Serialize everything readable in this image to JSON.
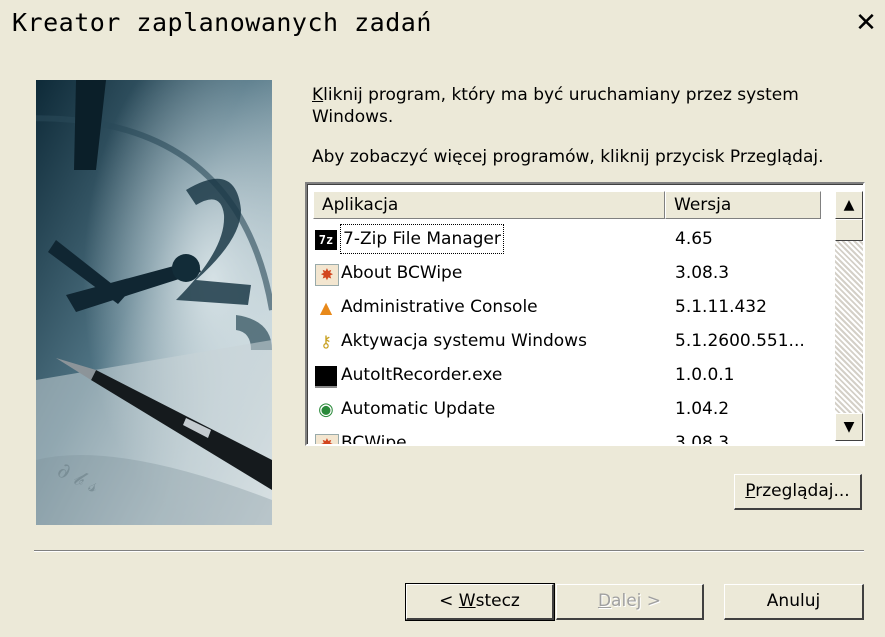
{
  "window": {
    "title": "Kreator zaplanowanych zadań",
    "close_glyph": "✕"
  },
  "instructions": {
    "line1_accel": "K",
    "line1_rest": "liknij program, który ma być uruchamiany przez system Windows.",
    "line2": "Aby zobaczyć więcej programów, kliknij przycisk Przeglądaj."
  },
  "list": {
    "columns": {
      "app": "Aplikacja",
      "version": "Wersja"
    },
    "rows": [
      {
        "name": "7-Zip File Manager",
        "version": "4.65",
        "icon": "sevenzip-icon",
        "selected": true
      },
      {
        "name": "About BCWipe",
        "version": "3.08.3",
        "icon": "bcwipe-icon"
      },
      {
        "name": "Administrative Console",
        "version": "5.1.11.432",
        "icon": "console-icon"
      },
      {
        "name": "Aktywacja systemu Windows",
        "version": "5.1.2600.551...",
        "icon": "keys-icon"
      },
      {
        "name": "AutoItRecorder.exe",
        "version": "1.0.0.1",
        "icon": "terminal-icon"
      },
      {
        "name": "Automatic Update",
        "version": "1.04.2",
        "icon": "globe-update-icon"
      },
      {
        "name": "BCWipe",
        "version": "3.08.3",
        "icon": "bcwipe-icon"
      }
    ],
    "scroll_up": "▲",
    "scroll_down": "▼"
  },
  "buttons": {
    "browse_accel": "P",
    "browse_rest": "rzeglądaj...",
    "back_prefix": "< ",
    "back_accel": "W",
    "back_rest": "stecz",
    "next_accel": "D",
    "next_rest": "alej >",
    "cancel": "Anuluj"
  },
  "colors": {
    "face": "#ece9d8",
    "list_bg": "#ffffff"
  }
}
